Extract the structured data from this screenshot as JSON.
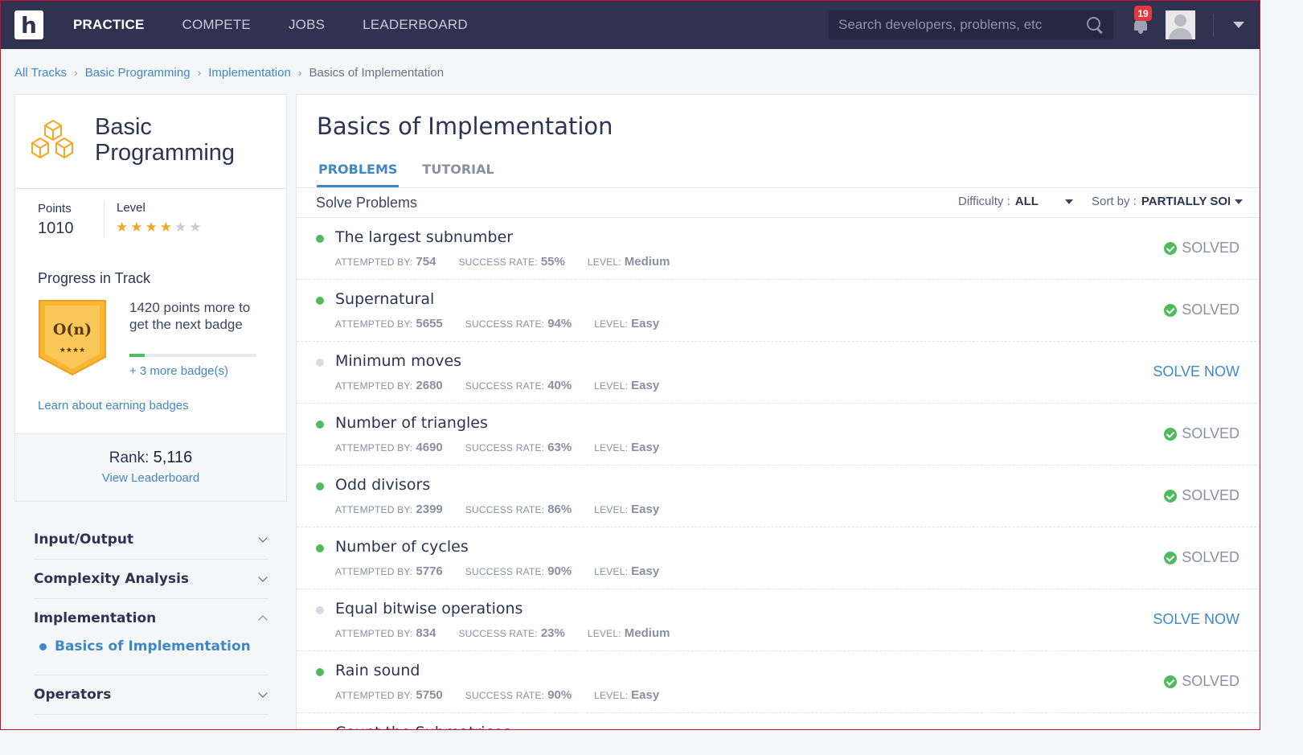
{
  "nav": {
    "logo_letter": "h",
    "links": [
      {
        "label": "PRACTICE",
        "active": true
      },
      {
        "label": "COMPETE",
        "active": false
      },
      {
        "label": "JOBS",
        "active": false
      },
      {
        "label": "LEADERBOARD",
        "active": false
      }
    ],
    "search_placeholder": "Search developers, problems, etc",
    "notifications": "19"
  },
  "breadcrumb": [
    "All Tracks",
    "Basic Programming",
    "Implementation",
    "Basics of Implementation"
  ],
  "track": {
    "title": "Basic Programming",
    "points_label": "Points",
    "points": "1010",
    "level_label": "Level",
    "level_stars_filled": 4,
    "level_stars_total": 6,
    "progress_title": "Progress in Track",
    "badge_symbol": "O(n)",
    "badge_stars": "★★★★",
    "badge_text": "1420 points more to get the next badge",
    "badge_progress_fraction": 0.12,
    "more_badges": "+ 3 more badge(s)",
    "learn_link": "Learn about earning badges",
    "rank_label": "Rank:",
    "rank": "5,116",
    "leaderboard_link": "View Leaderboard"
  },
  "topics": [
    {
      "label": "Input/Output",
      "open": false
    },
    {
      "label": "Complexity Analysis",
      "open": false
    },
    {
      "label": "Implementation",
      "open": true,
      "subtopic": "Basics of Implementation"
    },
    {
      "label": "Operators",
      "open": false
    }
  ],
  "main": {
    "title": "Basics of Implementation",
    "tabs": [
      {
        "label": "PROBLEMS",
        "active": true
      },
      {
        "label": "TUTORIAL",
        "active": false
      }
    ],
    "solve_label": "Solve Problems",
    "difficulty_label": "Difficulty :",
    "difficulty_value": "ALL",
    "sort_label": "Sort by :",
    "sort_value": "PARTIALLY SOLVED"
  },
  "meta_keys": {
    "attempted": "ATTEMPTED BY:",
    "success": "SUCCESS RATE:",
    "level": "LEVEL:"
  },
  "problems": [
    {
      "name": "The largest subnumber",
      "attempted": "754",
      "success": "55%",
      "level": "Medium",
      "status": "SOLVED"
    },
    {
      "name": "Supernatural",
      "attempted": "5655",
      "success": "94%",
      "level": "Easy",
      "status": "SOLVED"
    },
    {
      "name": "Minimum moves",
      "attempted": "2680",
      "success": "40%",
      "level": "Easy",
      "status": "SOLVE NOW"
    },
    {
      "name": "Number of triangles",
      "attempted": "4690",
      "success": "63%",
      "level": "Easy",
      "status": "SOLVED"
    },
    {
      "name": "Odd divisors",
      "attempted": "2399",
      "success": "86%",
      "level": "Easy",
      "status": "SOLVED"
    },
    {
      "name": "Number of cycles",
      "attempted": "5776",
      "success": "90%",
      "level": "Easy",
      "status": "SOLVED"
    },
    {
      "name": "Equal bitwise operations",
      "attempted": "834",
      "success": "23%",
      "level": "Medium",
      "status": "SOLVE NOW"
    },
    {
      "name": "Rain sound",
      "attempted": "5750",
      "success": "90%",
      "level": "Easy",
      "status": "SOLVED"
    },
    {
      "name": "Count the Submatrices",
      "attempted": "",
      "success": "",
      "level": "",
      "status": ""
    }
  ],
  "colors": {
    "nav_bg": "#2f3350",
    "accent": "#3f88c5",
    "solved_dot": "#4fbb5e",
    "unsolved_dot": "#d9dbe2",
    "star_filled": "#f5a623",
    "star_empty": "#c9ccd6",
    "badge_orange": "#f5a623"
  }
}
